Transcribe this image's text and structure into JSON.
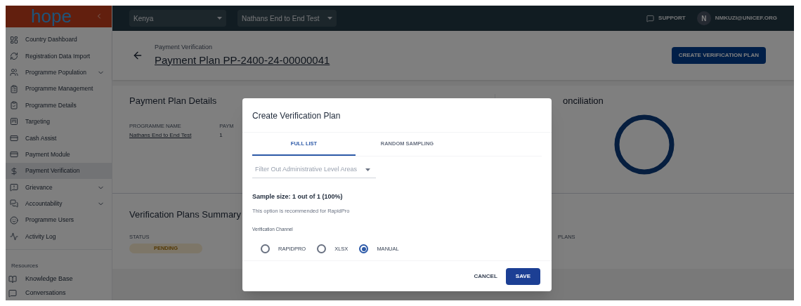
{
  "sidebar": {
    "logo": "hope",
    "items": [
      {
        "label": "Country Dashboard",
        "expandable": false,
        "selected": false
      },
      {
        "label": "Registration Data Import",
        "expandable": false,
        "selected": false
      },
      {
        "label": "Programme Population",
        "expandable": true,
        "selected": false
      },
      {
        "label": "Programme Management",
        "expandable": false,
        "selected": false
      },
      {
        "label": "Programme Details",
        "expandable": false,
        "selected": false
      },
      {
        "label": "Targeting",
        "expandable": false,
        "selected": false
      },
      {
        "label": "Cash Assist",
        "expandable": false,
        "selected": false
      },
      {
        "label": "Payment Module",
        "expandable": false,
        "selected": false
      },
      {
        "label": "Payment Verification",
        "expandable": false,
        "selected": true
      },
      {
        "label": "Grievance",
        "expandable": true,
        "selected": false
      },
      {
        "label": "Accountability",
        "expandable": true,
        "selected": false
      },
      {
        "label": "Programme Users",
        "expandable": false,
        "selected": false
      },
      {
        "label": "Activity Log",
        "expandable": false,
        "selected": false
      }
    ],
    "resources_heading": "Resources",
    "resources": [
      {
        "label": "Knowledge Base",
        "selected": false
      },
      {
        "label": "Conversations",
        "selected": false
      }
    ]
  },
  "topbar": {
    "country": "Kenya",
    "programme": "Nathans End to End Test",
    "support": "SUPPORT",
    "avatar_initial": "N",
    "user": "NMKUZI@UNICEF.ORG"
  },
  "header": {
    "breadcrumb": "Payment Verification",
    "title": "Payment Plan PP-2400-24-00000041",
    "action": "CREATE VERIFICATION PLAN"
  },
  "details": {
    "title": "Payment Plan Details",
    "fields": [
      {
        "label": "PROGRAMME NAME",
        "value": "Nathans End to End Test",
        "link": true
      },
      {
        "label": "PAYM",
        "value": "1",
        "link": false
      }
    ],
    "reconciliation_title": "onciliation"
  },
  "summary": {
    "title": "Verification Plans Summary",
    "status_label": "STATUS",
    "status": "PENDING",
    "plans_label": "PLANS"
  },
  "dialog": {
    "title": "Create Verification Plan",
    "tabs": [
      {
        "label": "FULL LIST",
        "selected": true
      },
      {
        "label": "RANDOM SAMPLING",
        "selected": false
      }
    ],
    "filter_placeholder": "Filter Out Administrative Level Areas",
    "sample_size": "Sample size: 1 out of 1 (100%)",
    "hint": "This option is recommended for RapidPro",
    "channel_label": "Verification Channel",
    "channels": [
      {
        "label": "RAPIDPRO",
        "selected": false
      },
      {
        "label": "XLSX",
        "selected": false
      },
      {
        "label": "MANUAL",
        "selected": true
      }
    ],
    "cancel": "CANCEL",
    "save": "SAVE"
  }
}
